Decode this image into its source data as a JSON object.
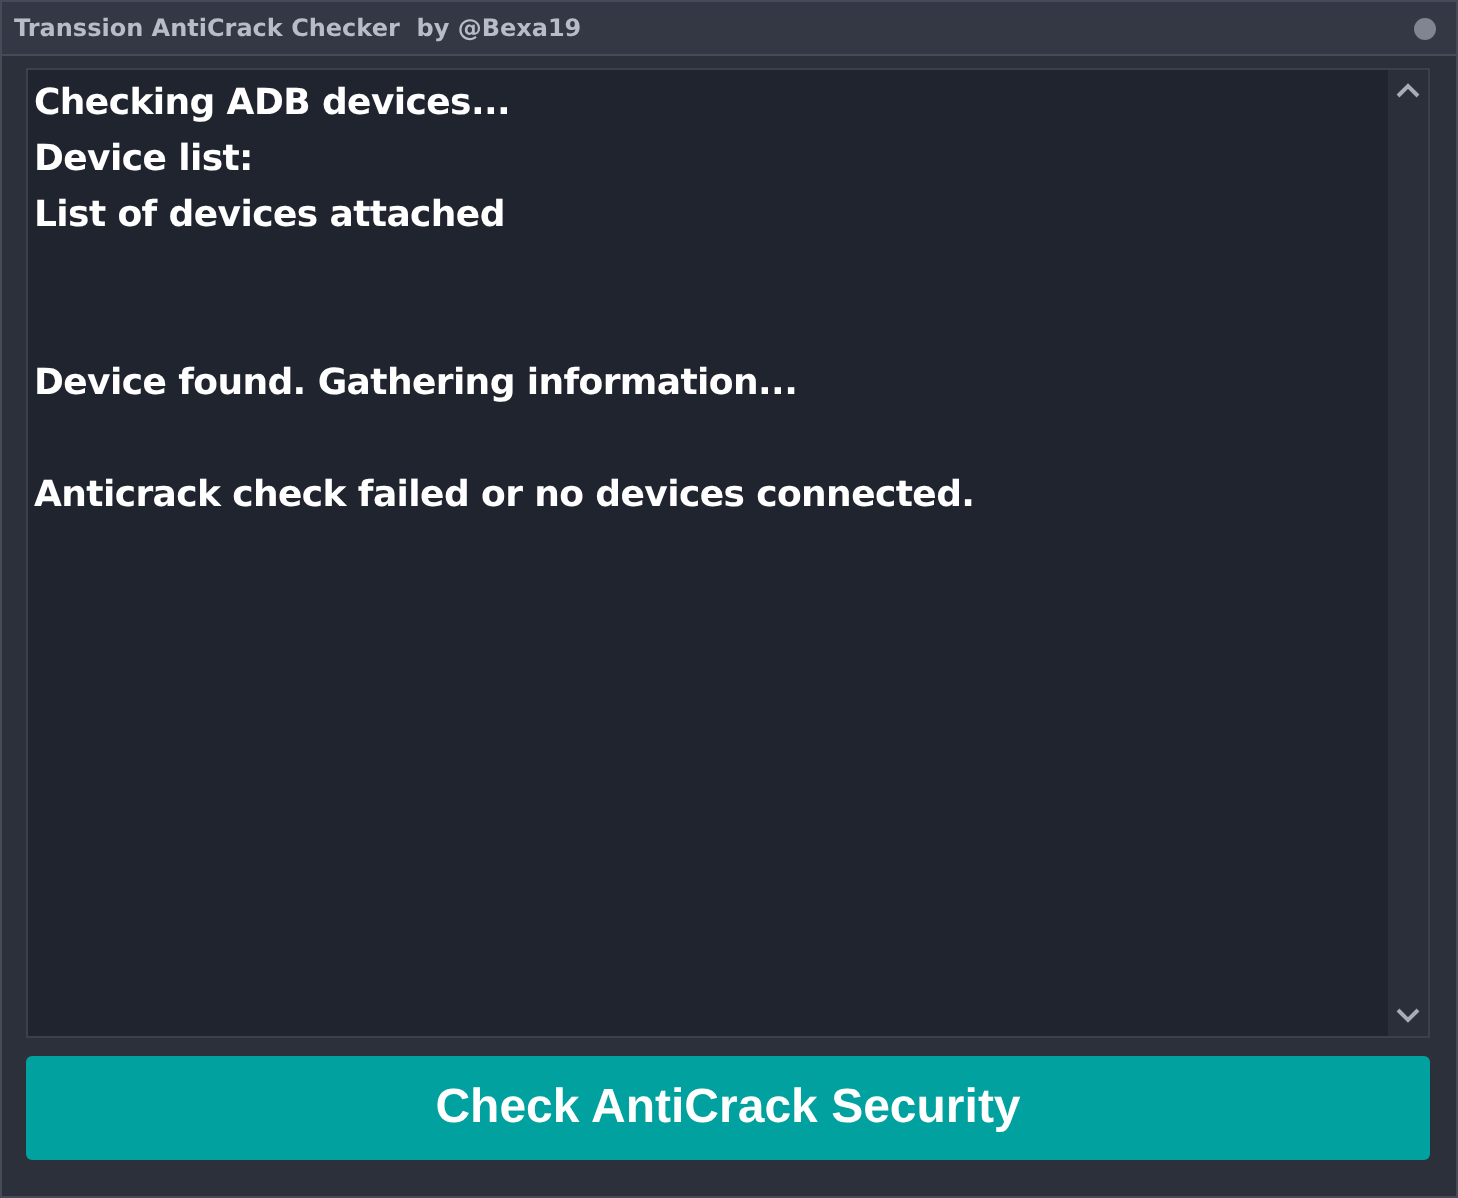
{
  "window": {
    "title": "Transsion AntiCrack Checker  by @Bexa19"
  },
  "log": {
    "text": "Checking ADB devices...\nDevice list:\nList of devices attached\n\n\nDevice found. Gathering information...\n\nAnticrack check failed or no devices connected."
  },
  "button": {
    "label": "Check AntiCrack Security"
  }
}
